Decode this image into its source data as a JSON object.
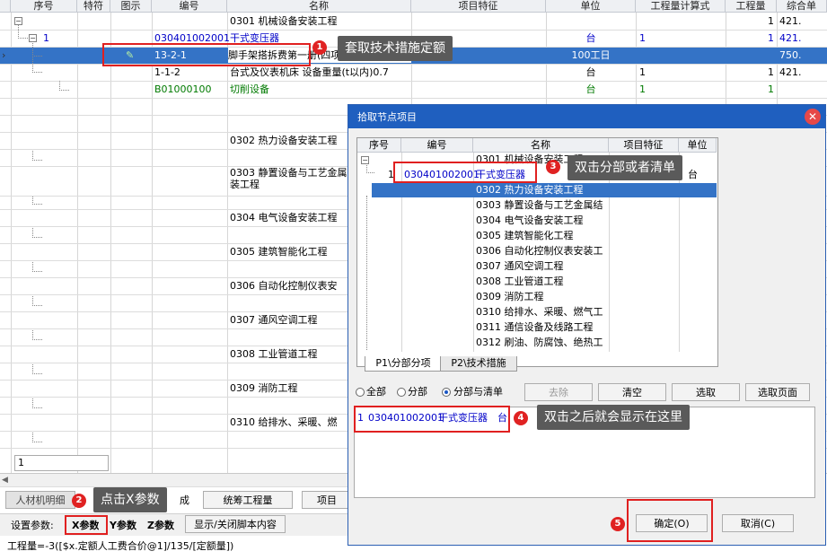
{
  "grid": {
    "headers": [
      "序号",
      "特符",
      "图示",
      "编号",
      "名称",
      "项目特征",
      "单位",
      "工程量计算式",
      "工程量",
      "综合单"
    ],
    "rows": [
      {
        "id": "r0",
        "code": "",
        "name": "0301 机械设备安装工程",
        "unit": "",
        "formula": "",
        "qty": "1",
        "price": "421."
      },
      {
        "id": "r1",
        "seq": "1",
        "code": "030401002001",
        "name": "干式变压器",
        "unit": "台",
        "formula": "1",
        "qty": "1",
        "price": "421."
      },
      {
        "id": "r2",
        "code": "13-2-1",
        "name": "脚手架搭拆费第一册(四项工单",
        "unit": "100工日",
        "formula": "",
        "qty": "",
        "price": "750."
      },
      {
        "id": "r3",
        "code": "1-1-2",
        "name": "台式及仪表机床 设备重量(t以内)0.7",
        "unit": "台",
        "formula": "1",
        "qty": "1",
        "price": "421."
      },
      {
        "id": "r4",
        "code": "B01000100",
        "name": "切削设备",
        "unit": "台",
        "formula": "1",
        "qty": "1",
        "price": ""
      },
      {
        "id": "r5",
        "name": "0302 热力设备安装工程"
      },
      {
        "id": "r6",
        "name": "0303 静置设备与工艺金属",
        "name2": "装工程"
      },
      {
        "id": "r7",
        "name": "0304 电气设备安装工程"
      },
      {
        "id": "r8",
        "name": "0305 建筑智能化工程"
      },
      {
        "id": "r9",
        "name": "0306 自动化控制仪表安"
      },
      {
        "id": "r10",
        "name": "0307 通风空调工程"
      },
      {
        "id": "r11",
        "name": "0308 工业管道工程"
      },
      {
        "id": "r12",
        "name": "0309 消防工程"
      },
      {
        "id": "r13",
        "name": "0310 给排水、采暖、燃"
      }
    ],
    "footer_value": "1"
  },
  "bottom": {
    "tabs": [
      "人材机明细",
      "统筹工程量",
      "项目"
    ],
    "tab_suffix": "成",
    "params_label": "设置参数:",
    "x_param": "X参数",
    "y_param": "Y参数",
    "z_param": "Z参数",
    "toggle_script": "显示/关闭脚本内容",
    "formula": "工程量=-3([$x.定额人工费合价@1]/135/[定额量])"
  },
  "dialog": {
    "title": "拾取节点项目",
    "headers": [
      "序号",
      "编号",
      "名称",
      "项目特征",
      "单位"
    ],
    "rows": [
      {
        "code": "",
        "name": "0301 机械设备安装工程"
      },
      {
        "seq": "1",
        "code": "030401002001",
        "name": "干式变压器",
        "unit": "台"
      },
      {
        "code": "",
        "name": "0302 热力设备安装工程"
      },
      {
        "code": "",
        "name": "0303 静置设备与工艺金属结"
      },
      {
        "code": "",
        "name": "0304 电气设备安装工程"
      },
      {
        "code": "",
        "name": "0305 建筑智能化工程"
      },
      {
        "code": "",
        "name": "0306 自动化控制仪表安装工"
      },
      {
        "code": "",
        "name": "0307 通风空调工程"
      },
      {
        "code": "",
        "name": "0308 工业管道工程"
      },
      {
        "code": "",
        "name": "0309 消防工程"
      },
      {
        "code": "",
        "name": "0310 给排水、采暖、燃气工"
      },
      {
        "code": "",
        "name": "0311 通信设备及线路工程"
      },
      {
        "code": "",
        "name": "0312 刷油、防腐蚀、绝热工"
      }
    ],
    "tabs": [
      "P1\\分部分项",
      "P2\\技术措施"
    ],
    "radios": [
      "全部",
      "分部",
      "分部与清单"
    ],
    "buttons": {
      "remove": "去除",
      "clear": "清空",
      "select": "选取",
      "select_page": "选取页面",
      "ok": "确定(O)",
      "cancel": "取消(C)"
    },
    "result": {
      "seq": "1",
      "code": "030401002001",
      "name": "干式变压器",
      "unit": "台"
    }
  },
  "callouts": {
    "c1": {
      "num": "1",
      "text": "套取技术措施定额"
    },
    "c2": {
      "num": "2",
      "text": "点击X参数"
    },
    "c3": {
      "num": "3",
      "text": "双击分部或者清单"
    },
    "c4": {
      "num": "4",
      "text": "双击之后就会显示在这里"
    },
    "c5": {
      "num": "5"
    }
  },
  "colors": {
    "selection": "#3473c6",
    "title_bar": "#1f5fbf",
    "callout_red": "#e02222",
    "callout_bg": "#5a5a5a"
  }
}
